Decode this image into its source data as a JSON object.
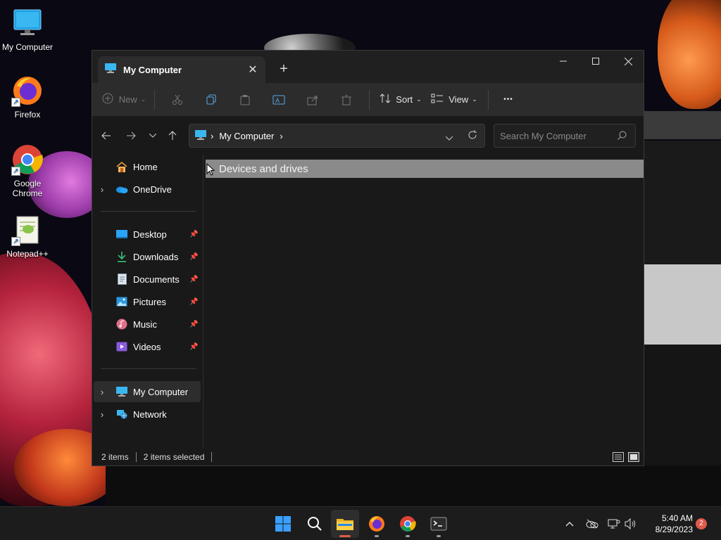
{
  "desktop": {
    "icons": [
      {
        "label": "My Computer",
        "icon": "monitor-icon"
      },
      {
        "label": "Firefox",
        "icon": "firefox-icon"
      },
      {
        "label": "Google Chrome",
        "icon": "chrome-icon"
      },
      {
        "label": "Notepad++",
        "icon": "notepadpp-icon"
      }
    ]
  },
  "window": {
    "tab_title": "My Computer",
    "tab_close_glyph": "✕",
    "new_tab_glyph": "+",
    "controls": {
      "minimize": "—",
      "maximize": "☐",
      "close": "✕"
    },
    "toolbar": {
      "new_label": "New",
      "sort_label": "Sort",
      "view_label": "View",
      "more_glyph": "•••"
    },
    "address": {
      "crumb_sep": "›",
      "path": "My Computer",
      "trailing_sep": "›"
    },
    "search": {
      "placeholder": "Search My Computer"
    },
    "nav": {
      "home": "Home",
      "onedrive": "OneDrive",
      "quick": [
        {
          "label": "Desktop"
        },
        {
          "label": "Downloads"
        },
        {
          "label": "Documents"
        },
        {
          "label": "Pictures"
        },
        {
          "label": "Music"
        },
        {
          "label": "Videos"
        }
      ],
      "my_computer": "My Computer",
      "network": "Network"
    },
    "content": {
      "group_header": "Devices and drives"
    },
    "status": {
      "items": "2 items",
      "selected": "2 items selected"
    }
  },
  "taskbar": {
    "time": "5:40 AM",
    "date": "8/29/2023",
    "notification_count": "2"
  },
  "colors": {
    "accent": "#0067c0",
    "explorer_active_indicator": "#e05a4a",
    "group_header_bg": "#8a8a8a"
  }
}
